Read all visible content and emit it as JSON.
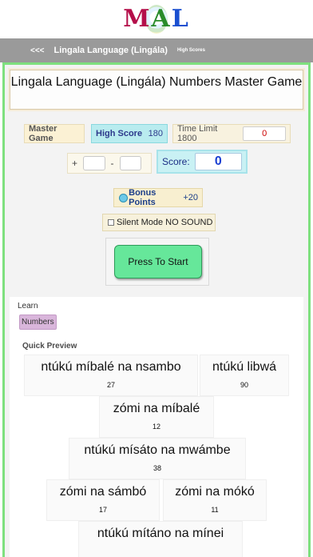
{
  "header": {
    "logo_text": "MAL",
    "logo_letters": [
      "M",
      "A",
      "L"
    ],
    "brand_colors": {
      "m": "#b40f4a",
      "a": "#2a8c2a",
      "l": "#1a4fd0"
    }
  },
  "nav": {
    "back_label": "<<<",
    "title": "Lingala Language (Lingála)",
    "high_scores_link": "High Scores",
    "bar_color": "#9a9a9a"
  },
  "game": {
    "title": "Lingala Language (Lingála) Numbers Master Game",
    "master_game_label": "Master Game",
    "high_score_label": "High Score",
    "high_score_value": "180",
    "time_limit_label": "Time Limit 1800",
    "time_value": "0",
    "plus_sign": "+",
    "minus_sign": "-",
    "score_label": "Score:",
    "score_value": "0",
    "bonus_label": "Bonus Points",
    "bonus_value": "+20",
    "silent_mode_label": "Silent Mode NO SOUND",
    "silent_mode_checked": false,
    "start_button": "Press To Start",
    "accent_color": "#66e79a"
  },
  "learn": {
    "label": "Learn",
    "numbers_chip": "Numbers",
    "quick_preview_label": "Quick Preview"
  },
  "preview": [
    {
      "word": "ntúkú míbalé na nsambo",
      "number": "27"
    },
    {
      "word": "ntúkú libwá",
      "number": "90"
    },
    {
      "word": "zómi na míbalé",
      "number": "12"
    },
    {
      "word": "ntúkú mísáto na mwámbe",
      "number": "38"
    },
    {
      "word": "zómi na sámbó",
      "number": "17"
    },
    {
      "word": "zómi na mókó",
      "number": "11"
    },
    {
      "word": "ntúkú mítáno na mínei",
      "number": ""
    }
  ]
}
